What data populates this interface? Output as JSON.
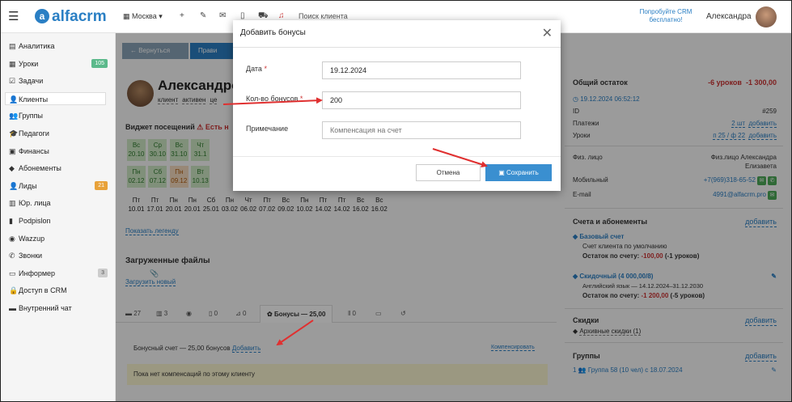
{
  "topbar": {
    "logo_text": "alfacrm",
    "branch": "Москва",
    "search_placeholder": "Поиск клиента",
    "promo": "Попробуйте CRM бесплатно!",
    "user_name": "Александра"
  },
  "sidebar": {
    "items": [
      {
        "label": "Аналитика",
        "icon": "chart-icon",
        "ico": "▤"
      },
      {
        "label": "Уроки",
        "icon": "lessons-icon",
        "ico": "▦",
        "badge": "105"
      },
      {
        "label": "Задачи",
        "icon": "tasks-icon",
        "ico": "☑"
      },
      {
        "label": "Клиенты",
        "icon": "user-icon",
        "ico": "👤"
      },
      {
        "label": "Группы",
        "icon": "group-icon",
        "ico": "👥"
      },
      {
        "label": "Педагоги",
        "icon": "teacher-icon",
        "ico": "🎓"
      },
      {
        "label": "Финансы",
        "icon": "finance-icon",
        "ico": "▣"
      },
      {
        "label": "Абонементы",
        "icon": "tag-icon",
        "ico": "◆"
      },
      {
        "label": "Лиды",
        "icon": "leads-icon",
        "ico": "👤",
        "badge": "21"
      },
      {
        "label": "Юр. лица",
        "icon": "building-icon",
        "ico": "▥"
      },
      {
        "label": "Podpislon",
        "icon": "doc-icon",
        "ico": "▮"
      },
      {
        "label": "Wazzup",
        "icon": "whatsapp-icon",
        "ico": "◉"
      },
      {
        "label": "Звонки",
        "icon": "phone-icon",
        "ico": "✆"
      },
      {
        "label": "Информер",
        "icon": "informer-icon",
        "ico": "▭",
        "badge": "3"
      },
      {
        "label": "Доступ в CRM",
        "icon": "lock-icon",
        "ico": "🔒"
      },
      {
        "label": "Внутренний чат",
        "icon": "chat-icon",
        "ico": "▬"
      }
    ]
  },
  "main": {
    "back_button": "← Вернуться",
    "edit_button": "Прави",
    "client_name": "Александро",
    "tags": [
      "клиент",
      "активен",
      "це"
    ],
    "widget_title": "Виджет посещений",
    "widget_warning": "⚠ Есть н",
    "visits_top": [
      {
        "day": "Вс",
        "date": "20.10",
        "style": "green"
      },
      {
        "day": "Ср",
        "date": "30.10",
        "style": "green"
      },
      {
        "day": "Вс",
        "date": "31.10",
        "style": "green"
      },
      {
        "day": "Чт",
        "date": "31.1",
        "style": "green"
      },
      {
        "day": "Пн",
        "date": "02.12",
        "style": "green"
      },
      {
        "day": "Сб",
        "date": "07.12",
        "style": "green"
      },
      {
        "day": "Пн",
        "date": "09.12",
        "style": "orange"
      },
      {
        "day": "Вт",
        "date": "10.13",
        "style": "green"
      }
    ],
    "visits_bottom": [
      {
        "day": "Пт",
        "date": "10.01"
      },
      {
        "day": "Пт",
        "date": "17.01"
      },
      {
        "day": "Пн",
        "date": "20.01"
      },
      {
        "day": "Пн",
        "date": "20.01"
      },
      {
        "day": "Сб",
        "date": "25.01"
      },
      {
        "day": "Пн",
        "date": "03.02"
      },
      {
        "day": "Чт",
        "date": "06.02"
      },
      {
        "day": "Пт",
        "date": "07.02"
      },
      {
        "day": "Вс",
        "date": "09.02"
      },
      {
        "day": "Пн",
        "date": "10.02"
      },
      {
        "day": "Пт",
        "date": "14.02"
      },
      {
        "day": "Пт",
        "date": "14.02"
      },
      {
        "day": "Вс",
        "date": "16.02"
      },
      {
        "day": "Вс",
        "date": "16.02"
      }
    ],
    "legend_link": "Показать легенду",
    "files_title": "Загруженные файлы",
    "upload_link": "Загрузить новый",
    "tabs": [
      "27",
      "3",
      "",
      "0",
      "0",
      "Бонусы — 25,00",
      "0",
      "",
      ""
    ],
    "bonus_text": "Бонусный счет — 25,00 бонусов",
    "bonus_add": "Добавить",
    "compensate": "Компенсировать",
    "no_compensations": "Пока нет компенсаций по этому клиенту"
  },
  "right": {
    "balance_title": "Общий остаток",
    "balance_lessons": "-6 уроков",
    "balance_sum": "-1 300,00",
    "date": "19.12.2024 06:52:12",
    "id_label": "ID",
    "id_value": "#259",
    "payments_label": "Платежи",
    "payments_value": "2 шт",
    "payments_add": "добавить",
    "lessons_label": "Уроки",
    "lessons_value": "п 25 / ф 22",
    "lessons_add": "добавить",
    "entity_label": "Физ. лицо",
    "entity_value": "Физ.лицо Александра Елизавета",
    "mobile_label": "Мобильный",
    "mobile_value": "+7(969)318-65-52",
    "email_label": "E-mail",
    "email_value": "4991@alfacrm.pro",
    "accounts_title": "Счета и абонементы",
    "accounts_add": "добавить",
    "base_account": "Базовый счет",
    "base_default": "Счет клиента по умолчанию",
    "base_balance_label": "Остаток по счету:",
    "base_balance_value": "-100,00",
    "base_balance_lessons": "(-1 уроков)",
    "discount_account": "Скидочный (4 000,00/8)",
    "discount_desc": "Английский язык — 14.12.2024–31.12.2030",
    "discount_balance_label": "Остаток по счету:",
    "discount_balance_value": "-1 200,00",
    "discount_balance_lessons": "(-5 уроков)",
    "discounts_title": "Скидки",
    "discounts_add": "добавить",
    "archive_discounts": "Архивные скидки (1)",
    "groups_title": "Группы",
    "groups_add": "добавить",
    "group_item": "Группа 58 (10 чел) с 18.07.2024"
  },
  "modal": {
    "title": "Добавить бонусы",
    "date_label": "Дата",
    "date_value": "19.12.2024",
    "count_label": "Кол-во бонусов",
    "count_value": "200",
    "note_label": "Примечание",
    "note_placeholder": "Компенсация на счет",
    "cancel": "Отмена",
    "save": "Сохранить"
  },
  "colors": {
    "accent": "#2a7fc4",
    "save": "#3a8fd0",
    "annotation_arrow": "#e03030",
    "green": "#4caa58"
  }
}
